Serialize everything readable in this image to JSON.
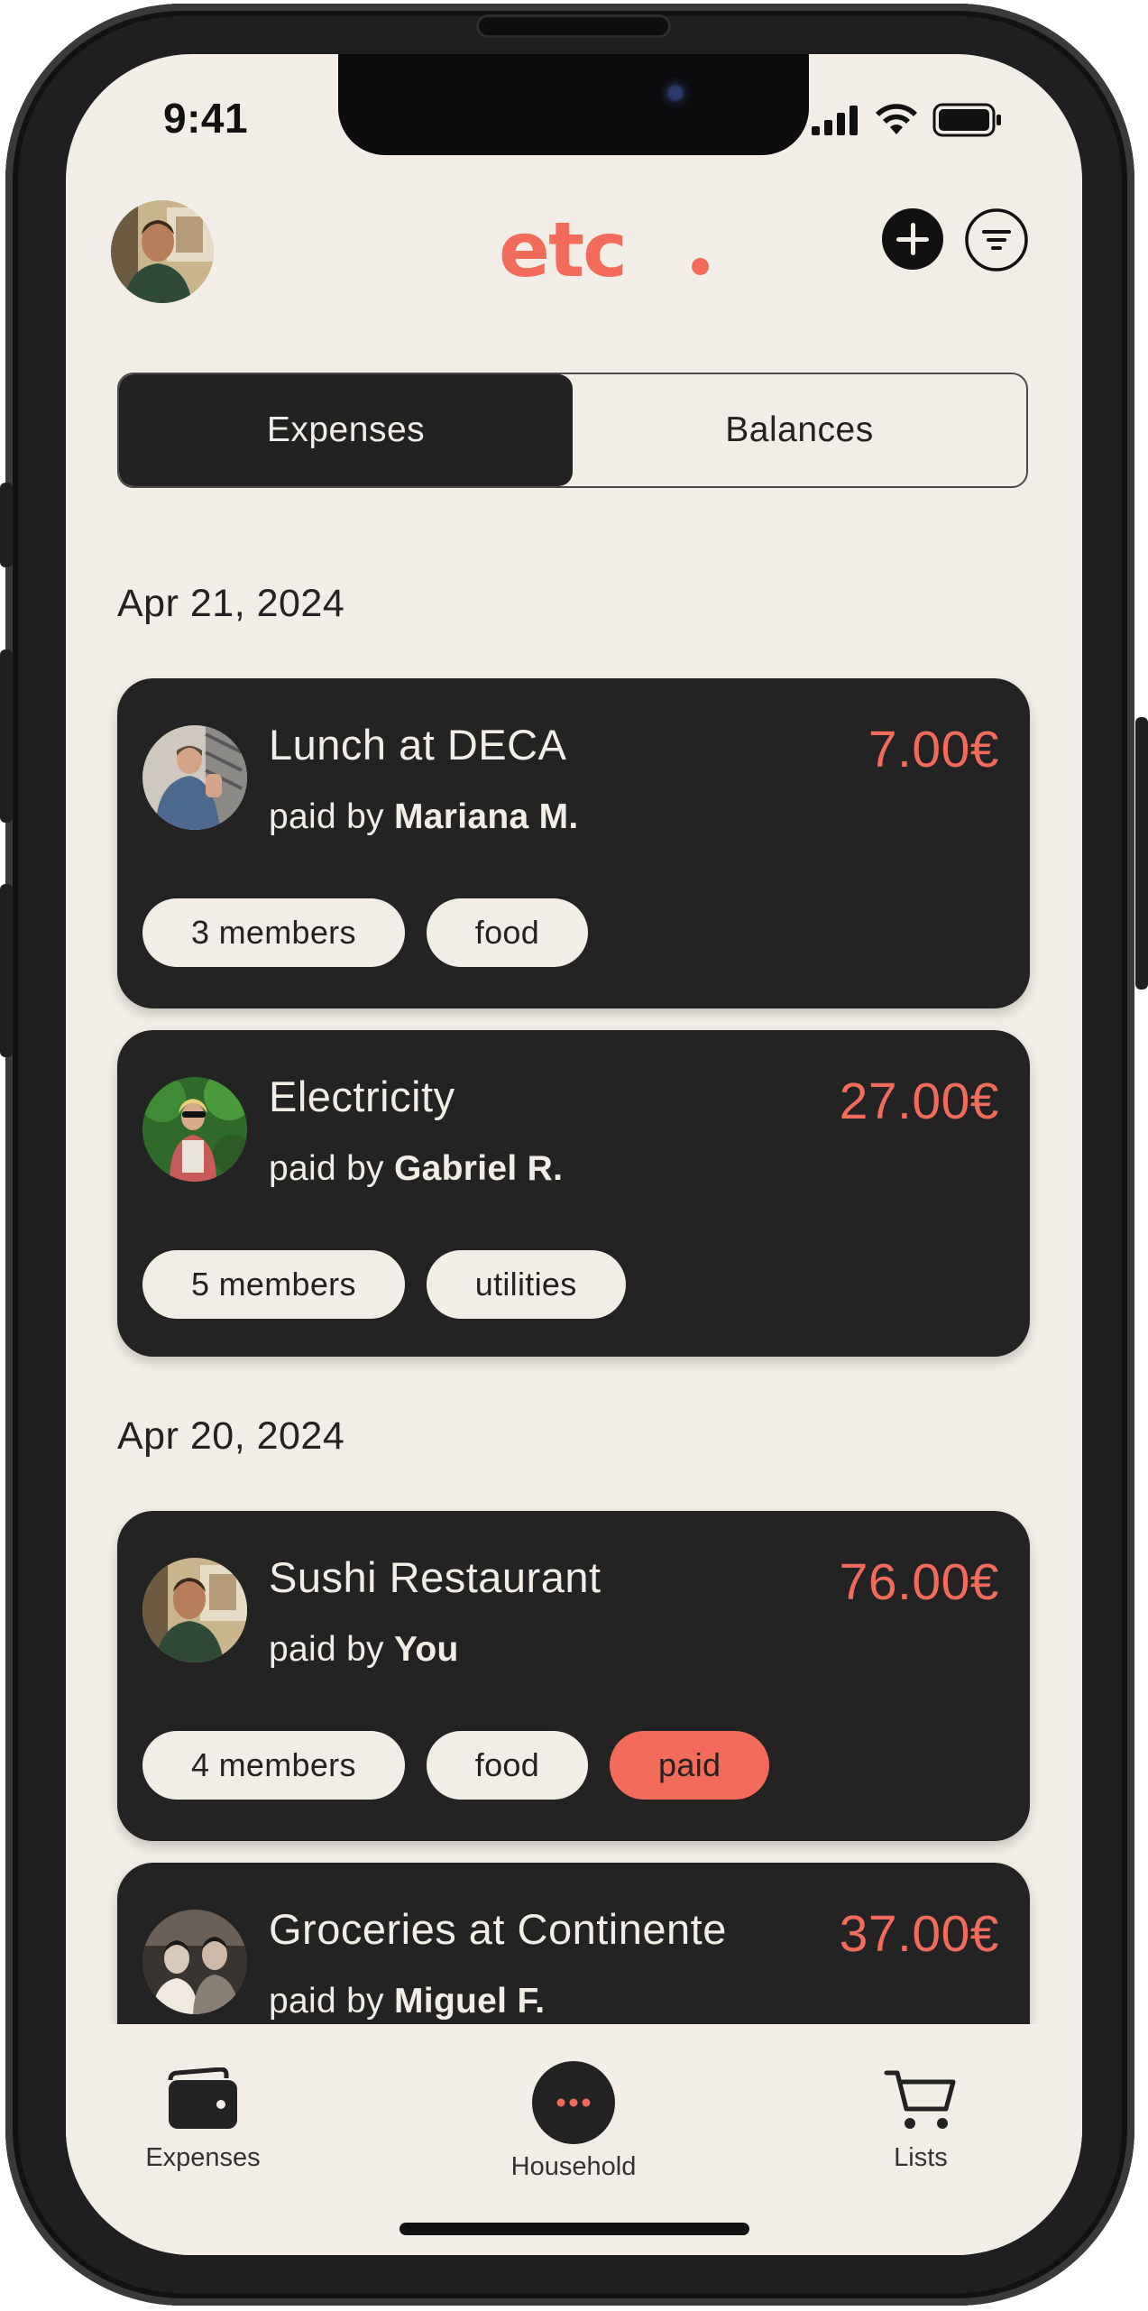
{
  "status_bar": {
    "time": "9:41"
  },
  "header": {
    "logo": "etc"
  },
  "tabs": [
    {
      "label": "Expenses",
      "active": true
    },
    {
      "label": "Balances",
      "active": false
    }
  ],
  "groups": [
    {
      "date": "Apr 21, 2024",
      "expenses": [
        {
          "title": "Lunch at DECA",
          "paid_by_prefix": "paid by",
          "payer": "Mariana M.",
          "amount": "7.00€",
          "tags": [
            "3 members",
            "food"
          ]
        },
        {
          "title": "Electricity",
          "paid_by_prefix": "paid by",
          "payer": "Gabriel R.",
          "amount": "27.00€",
          "tags": [
            "5 members",
            "utilities"
          ]
        }
      ]
    },
    {
      "date": "Apr 20, 2024",
      "expenses": [
        {
          "title": "Sushi Restaurant",
          "paid_by_prefix": "paid by",
          "payer": "You",
          "amount": "76.00€",
          "tags": [
            "4 members",
            "food",
            "paid"
          ]
        },
        {
          "title": "Groceries at Continente",
          "paid_by_prefix": "paid by",
          "payer": "Miguel F.",
          "amount": "37.00€",
          "tags": []
        }
      ]
    }
  ],
  "bottom_nav": [
    {
      "label": "Expenses",
      "icon": "wallet-icon"
    },
    {
      "label": "Household",
      "icon": "more-icon"
    },
    {
      "label": "Lists",
      "icon": "cart-icon"
    }
  ],
  "colors": {
    "accent": "#f26b5b",
    "background": "#f2ede6",
    "card": "#232323"
  }
}
